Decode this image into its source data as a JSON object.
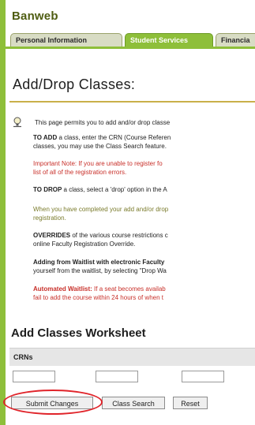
{
  "app": {
    "brand": "Banweb"
  },
  "tabs": [
    {
      "label": "Personal Information",
      "active": false
    },
    {
      "label": "Student Services",
      "active": true
    },
    {
      "label": "Financia",
      "active": false
    }
  ],
  "page": {
    "title": "Add/Drop Classes:"
  },
  "info": {
    "intro": "This page permits you to add and/or drop classe",
    "to_add_label": "TO ADD",
    "to_add_line1": " a class, enter the CRN (Course Referen",
    "to_add_line2": "classes, you may use the Class Search feature.",
    "important_line1": "Important Note: If you are unable to register fo",
    "important_line2": "list of all of the registration errors.",
    "to_drop_label": "TO DROP",
    "to_drop_line1": " a class, select a 'drop' option in the A",
    "completed_line1": "When you have completed your add and/or drop",
    "completed_line2": "registration.",
    "overrides_label": "OVERRIDES",
    "overrides_line1": " of the various course restrictions c",
    "overrides_line2": "online Faculty Registration Override.",
    "waitlist_label": "Adding from Waitlist with electronic Faculty",
    "waitlist_line2": "yourself from the waitlist, by selecting \"Drop Wa",
    "auto_label": "Automated Waitlist:",
    "auto_line1": " If a seat becomes availab",
    "auto_line2": "fail to add the course within 24 hours of when t"
  },
  "worksheet": {
    "title": "Add Classes Worksheet",
    "crn_header": "CRNs",
    "crn_values": [
      "",
      "",
      ""
    ]
  },
  "buttons": {
    "submit": "Submit Changes",
    "class_search": "Class Search",
    "reset": "Reset"
  },
  "colors": {
    "accent_green": "#8ebf3a",
    "brand_text": "#4f5d12",
    "warning_red": "#c8302a",
    "highlight_red": "#e0242a"
  }
}
